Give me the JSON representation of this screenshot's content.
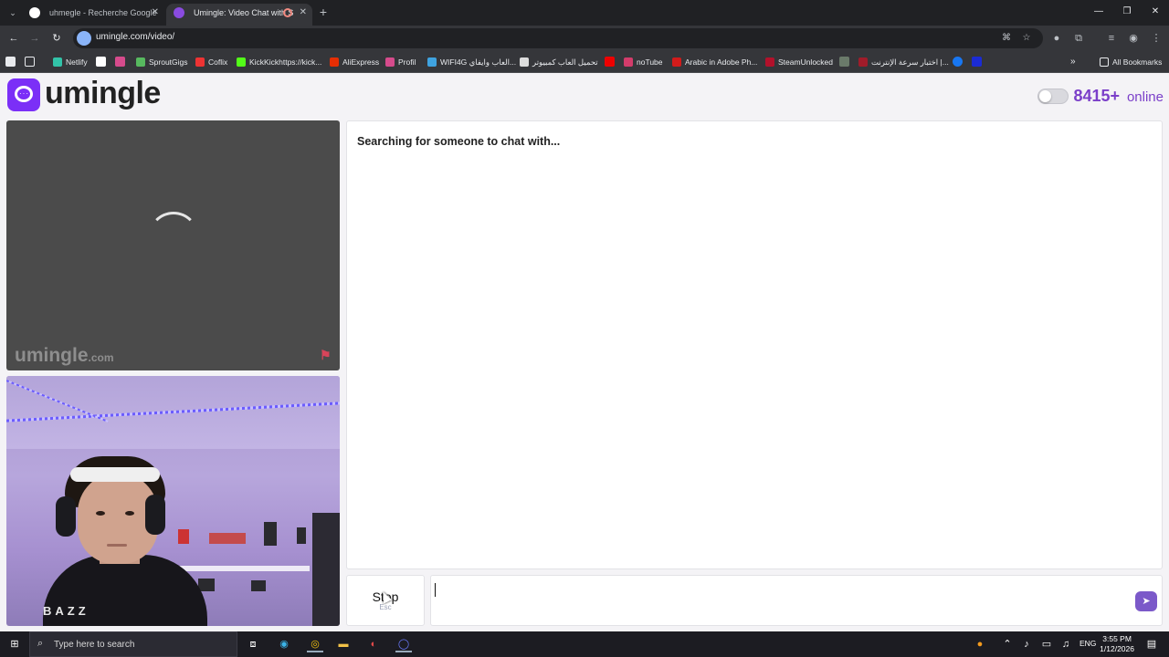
{
  "browser": {
    "tabs": [
      {
        "title": "uhmegle - Recherche Google",
        "active": false
      },
      {
        "title": "Umingle: Video Chat with S",
        "active": true
      }
    ],
    "url": "umingle.com/video/",
    "bookmarks": [
      "Netlify",
      "SproutGigs",
      "Coflix",
      "KickKickhttps://kick...",
      "AliExpress",
      "Profil",
      "WIFI4G العاب وايفاي...",
      "تحميل العاب كمبيوتر",
      "noTube",
      "Arabic in Adobe Ph...",
      "SteamUnlocked",
      "اختبار سرعة الإنترنت |..."
    ],
    "all_bookmarks": "All Bookmarks"
  },
  "site": {
    "logo_text": "umingle",
    "online_count": "8415+",
    "online_label": "online",
    "watermark": "umingle",
    "watermark_suffix": ".com",
    "chat_status": "Searching for someone to chat with...",
    "stop_label": "Stop",
    "stop_hint": "Esc"
  },
  "self_video": {
    "shirt_text": "BAZZ"
  },
  "taskbar": {
    "search_placeholder": "Type here to search",
    "language": "ENG",
    "time": "3:55 PM",
    "date": "1/12/2026"
  },
  "colors": {
    "brand": "#7b2ff7",
    "online_text": "#7b3fc9",
    "send_button": "#7b59c9"
  }
}
